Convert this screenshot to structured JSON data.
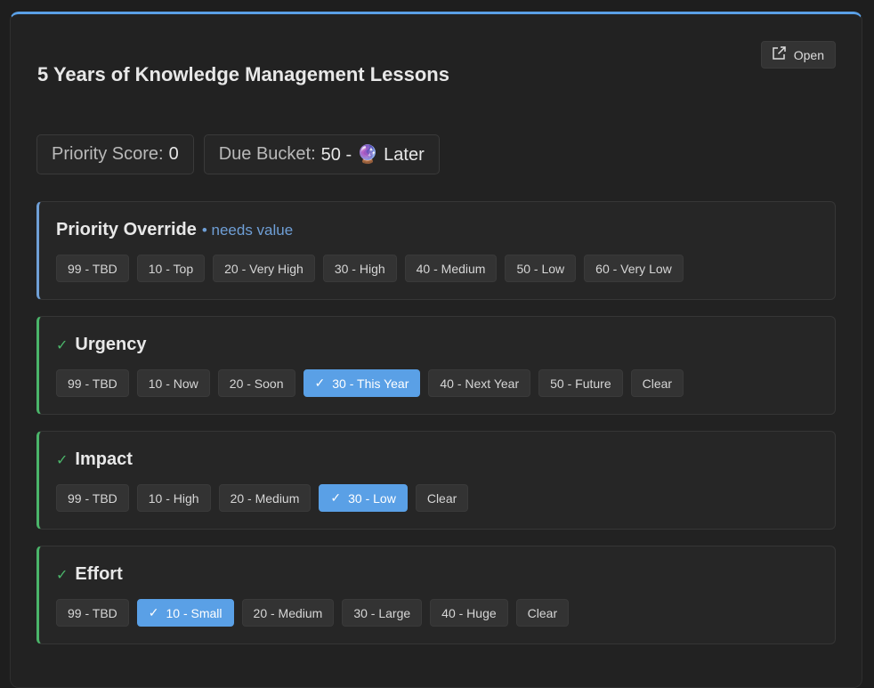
{
  "card": {
    "title": "5 Years of Knowledge Management Lessons",
    "open_label": "Open"
  },
  "stats": {
    "priority_label": "Priority Score:",
    "priority_value": "0",
    "due_label": "Due Bucket:",
    "due_value": "50 - 🔮 Later"
  },
  "colors": {
    "accent": "#5aa0e6",
    "done": "#4bb56a",
    "pending": "#6f9fd6"
  },
  "sections": {
    "override": {
      "title": "Priority Override",
      "needs": "• needs value",
      "options": [
        "99 - TBD",
        "10 - Top",
        "20 - Very High",
        "30 - High",
        "40 - Medium",
        "50 - Low",
        "60 - Very Low"
      ]
    },
    "urgency": {
      "check": "✓",
      "title": "Urgency",
      "options": [
        "99 - TBD",
        "10 - Now",
        "20 - Soon",
        "30 - This Year",
        "40 - Next Year",
        "50 - Future",
        "Clear"
      ],
      "selected": "30 - This Year"
    },
    "impact": {
      "check": "✓",
      "title": "Impact",
      "options": [
        "99 - TBD",
        "10 - High",
        "20 - Medium",
        "30 - Low",
        "Clear"
      ],
      "selected": "30 - Low"
    },
    "effort": {
      "check": "✓",
      "title": "Effort",
      "options": [
        "99 - TBD",
        "10 - Small",
        "20 - Medium",
        "30 - Large",
        "40 - Huge",
        "Clear"
      ],
      "selected": "10 - Small"
    }
  }
}
